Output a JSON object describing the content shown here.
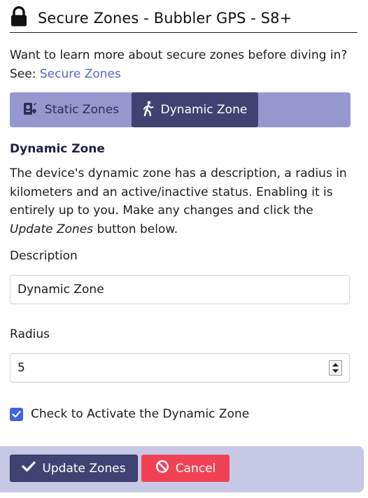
{
  "header": {
    "title": "Secure Zones - Bubbler GPS - S8+",
    "icon": "lock-icon"
  },
  "intro": {
    "text": "Want to learn more about secure zones before diving in?",
    "see_prefix": "See: ",
    "link_label": "Secure Zones"
  },
  "tabs": [
    {
      "label": "Static Zones",
      "icon": "map-pin-icon",
      "active": false
    },
    {
      "label": "Dynamic Zone",
      "icon": "walking-person-icon",
      "active": true
    }
  ],
  "section": {
    "title": "Dynamic Zone",
    "desc_part1": "The device's dynamic zone has a description, a radius in kilometers and an active/inactive status. Enabling it is entirely up to you. Make any changes and click the ",
    "desc_em": "Update Zones",
    "desc_part2": " button below."
  },
  "form": {
    "description_label": "Description",
    "description_value": "Dynamic Zone",
    "radius_label": "Radius",
    "radius_value": "5",
    "activate_label": "Check to Activate the Dynamic Zone",
    "activate_checked": true
  },
  "buttons": {
    "update_label": "Update Zones",
    "cancel_label": "Cancel"
  },
  "colors": {
    "accent": "#404371",
    "tab_bar": "#9598cf",
    "footer": "#c6c8e6",
    "cancel": "#f14254",
    "link": "#5468c9",
    "checkbox": "#3e63dd"
  }
}
